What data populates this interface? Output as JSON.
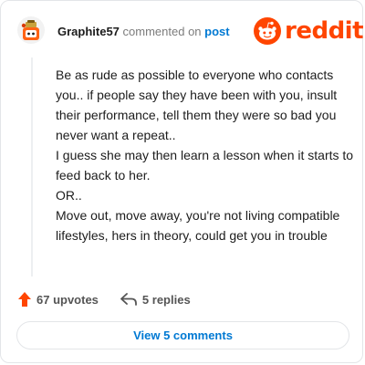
{
  "comment": {
    "username": "Graphite57",
    "commented_on": "commented on",
    "post_link": "post",
    "paragraphs": [
      "Be as rude as possible to everyone who contacts you.. if people say they have been with you, insult their performance, tell them they were so bad you never want a repeat..",
      "I guess she may then learn a lesson when it starts to feed back to her.",
      "OR..",
      "Move out, move away, you're not living compatible lifestyles, hers in theory, could get you in trouble"
    ],
    "upvotes": "67 upvotes",
    "replies": "5 replies"
  },
  "brand": {
    "wordmark": "reddit",
    "accent_color": "#ff4500",
    "link_color": "#0079d3"
  },
  "footer": {
    "view_comments_label": "View 5 comments"
  },
  "icons": {
    "avatar": "snoo-avatar-icon",
    "logo": "reddit-alien-icon",
    "upvote": "upvote-arrow-icon",
    "reply": "reply-arrow-icon"
  }
}
